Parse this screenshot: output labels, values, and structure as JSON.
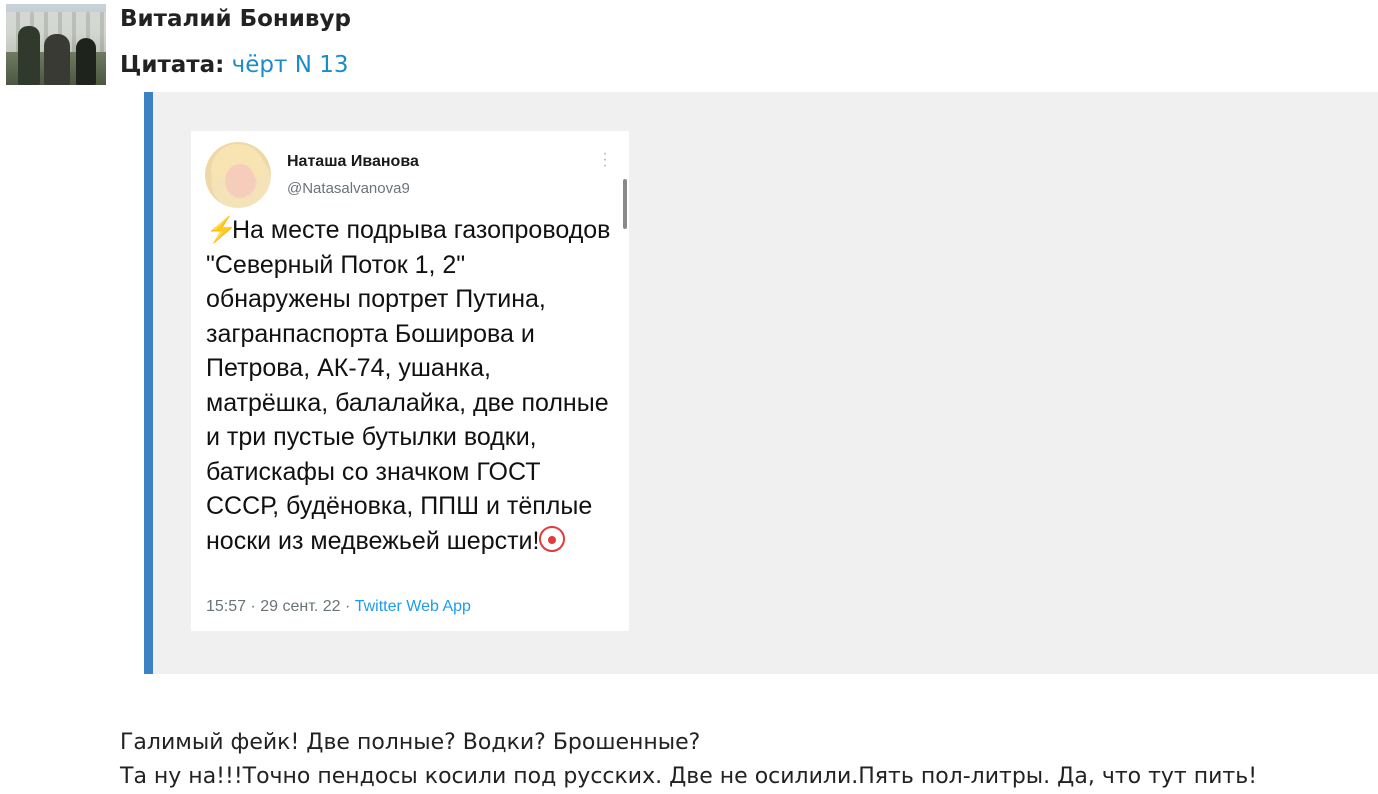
{
  "post": {
    "author": "Виталий Бонивур",
    "quote_label": "Цитата:",
    "quote_source": "чёрт N 13"
  },
  "tweet": {
    "name": "Наташа Иванова",
    "handle": "@Natasalvanova9",
    "more_icon": "more-vertical-icon",
    "lead_icon": "lightning-icon",
    "trail_icon": "clown-face-icon",
    "text": "На месте подрыва газопроводов \"Северный Поток 1, 2\" обнаружены портрет Путина, загранпаспорта Боширова и Петрова, АК-74, ушанка, матрёшка, балалайка, две полные и три пустые бутылки водки, батискафы со значком ГОСТ СССР, будёновка, ППШ и тёплые носки из медвежьей шерсти!",
    "time": "15:57",
    "date": "29 сент. 22",
    "separator": "·",
    "app": "Twitter Web App"
  },
  "reply": {
    "line1": "Галимый фейк! Две полные? Водки? Брошенные?",
    "line2": "Та ну на!!!Точно пендосы косили под русских. Две не осилили.Пять пол-литры. Да, что тут пить!"
  },
  "colors": {
    "link": "#1a8cc7",
    "quote_border": "#3b82c4",
    "quote_bg": "#f0f0f0",
    "twitter_blue": "#1d9bf0"
  }
}
